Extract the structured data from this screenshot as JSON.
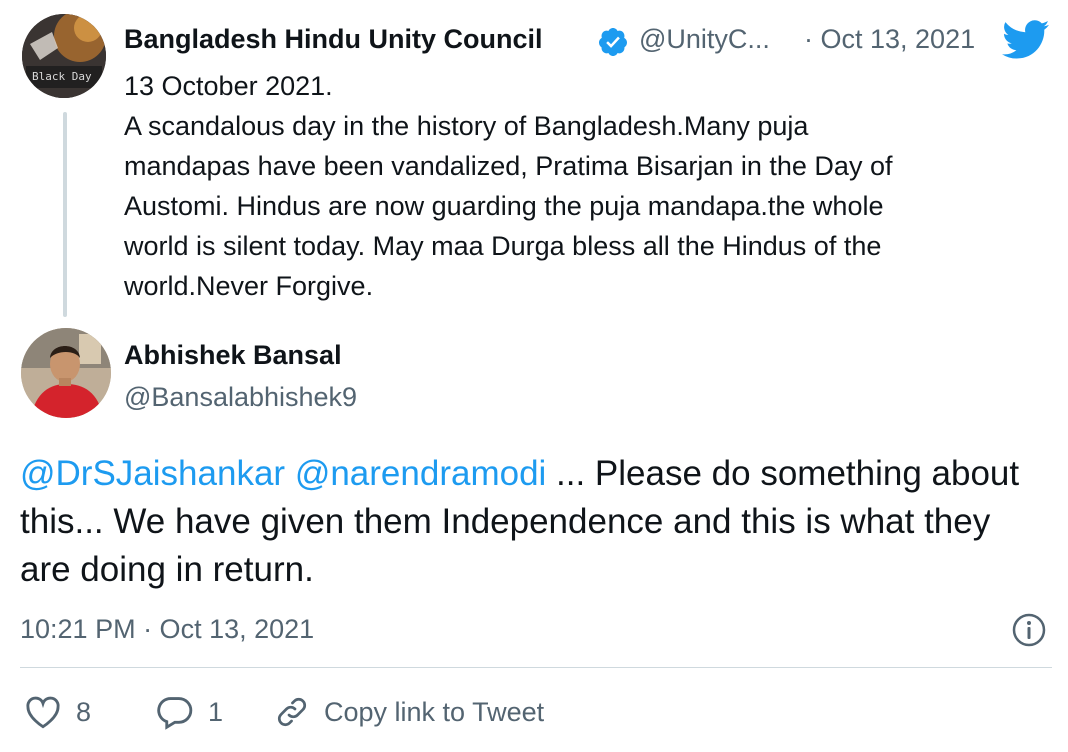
{
  "parent_tweet": {
    "author_name": "Bangladesh Hindu Unity Council",
    "handle": "@UnityC...",
    "date": "· Oct 13, 2021",
    "text": "13 October 2021.\nA scandalous day in the history of Bangladesh.Many puja\nmandapas have been vandalized, Pratima Bisarjan in the Day of\nAustomi. Hindus are now guarding the puja mandapa.the whole\nworld is silent today. May maa Durga bless all the Hindus of the\nworld.Never Forgive.",
    "avatar_caption": "Black Day",
    "verified_icon": "verified-badge-icon",
    "brand_icon": "twitter-bird-icon"
  },
  "reply_tweet": {
    "author_name": "Abhishek Bansal",
    "handle": "@Bansalabhishek9",
    "mention_1": "@DrSJaishankar",
    "mention_2": "@narendramodi",
    "text": " ... Please do something about this... We have given them Independence and this is what they are doing in return.",
    "timestamp": "10:21 PM · Oct 13, 2021"
  },
  "actions": {
    "like_count": "8",
    "reply_count": "1",
    "copy_link_label": "Copy link to Tweet"
  },
  "colors": {
    "accent": "#1d9bf0",
    "secondary_text": "#536471",
    "divider": "#cfd9de"
  }
}
